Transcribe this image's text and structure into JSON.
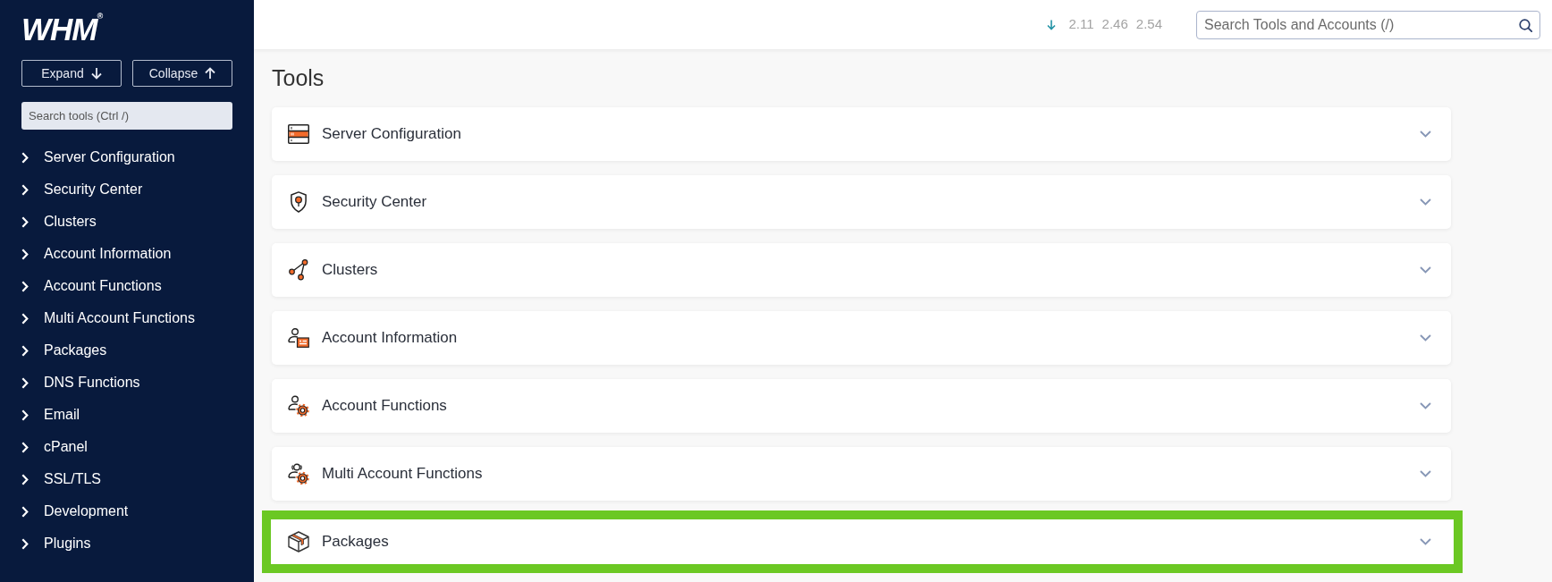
{
  "sidebar": {
    "logo": "WHM$^{®}$",
    "buttons": [
      {
        "label": "Expand",
        "kind": "expand"
      },
      {
        "label": "Collapse",
        "kind": "collapse"
      }
    ],
    "search": {
      "placeholder": "Search tools (Ctrl /)"
    },
    "items": [
      {
        "label": "Server Configuration",
        "expanded": false
      },
      {
        "label": "Security Center",
        "expanded": false
      },
      {
        "label": "Clusters",
        "expanded": false
      },
      {
        "label": "Account Information",
        "expanded": false
      },
      {
        "label": "Account Functions",
        "expanded": false
      },
      {
        "label": "Multi Account Functions",
        "expanded": false
      },
      {
        "label": "Packages",
        "expanded": false
      },
      {
        "label": "DNS Functions",
        "expanded": false
      },
      {
        "label": "Email",
        "expanded": false
      },
      {
        "label": "cPanel",
        "expanded": false
      },
      {
        "label": "SSL/TLS",
        "expanded": false
      },
      {
        "label": "Development",
        "expanded": false
      },
      {
        "label": "Plugins",
        "expanded": false
      }
    ]
  },
  "header": {
    "load_averages": [
      "2.11",
      "2.46",
      "2.54"
    ],
    "search": {
      "placeholder": "Search Tools and Accounts (/)"
    }
  },
  "page": {
    "title": "Tools",
    "sections": [
      {
        "label": "Server Configuration",
        "expanded": false,
        "highlighted": false
      },
      {
        "label": "Security Center",
        "expanded": false,
        "highlighted": false
      },
      {
        "label": "Clusters",
        "expanded": false,
        "highlighted": false
      },
      {
        "label": "Account Information",
        "expanded": false,
        "highlighted": false
      },
      {
        "label": "Account Functions",
        "expanded": false,
        "highlighted": false
      },
      {
        "label": "Multi Account Functions",
        "expanded": false,
        "highlighted": false
      },
      {
        "label": "Packages",
        "expanded": false,
        "highlighted": true
      }
    ]
  }
}
